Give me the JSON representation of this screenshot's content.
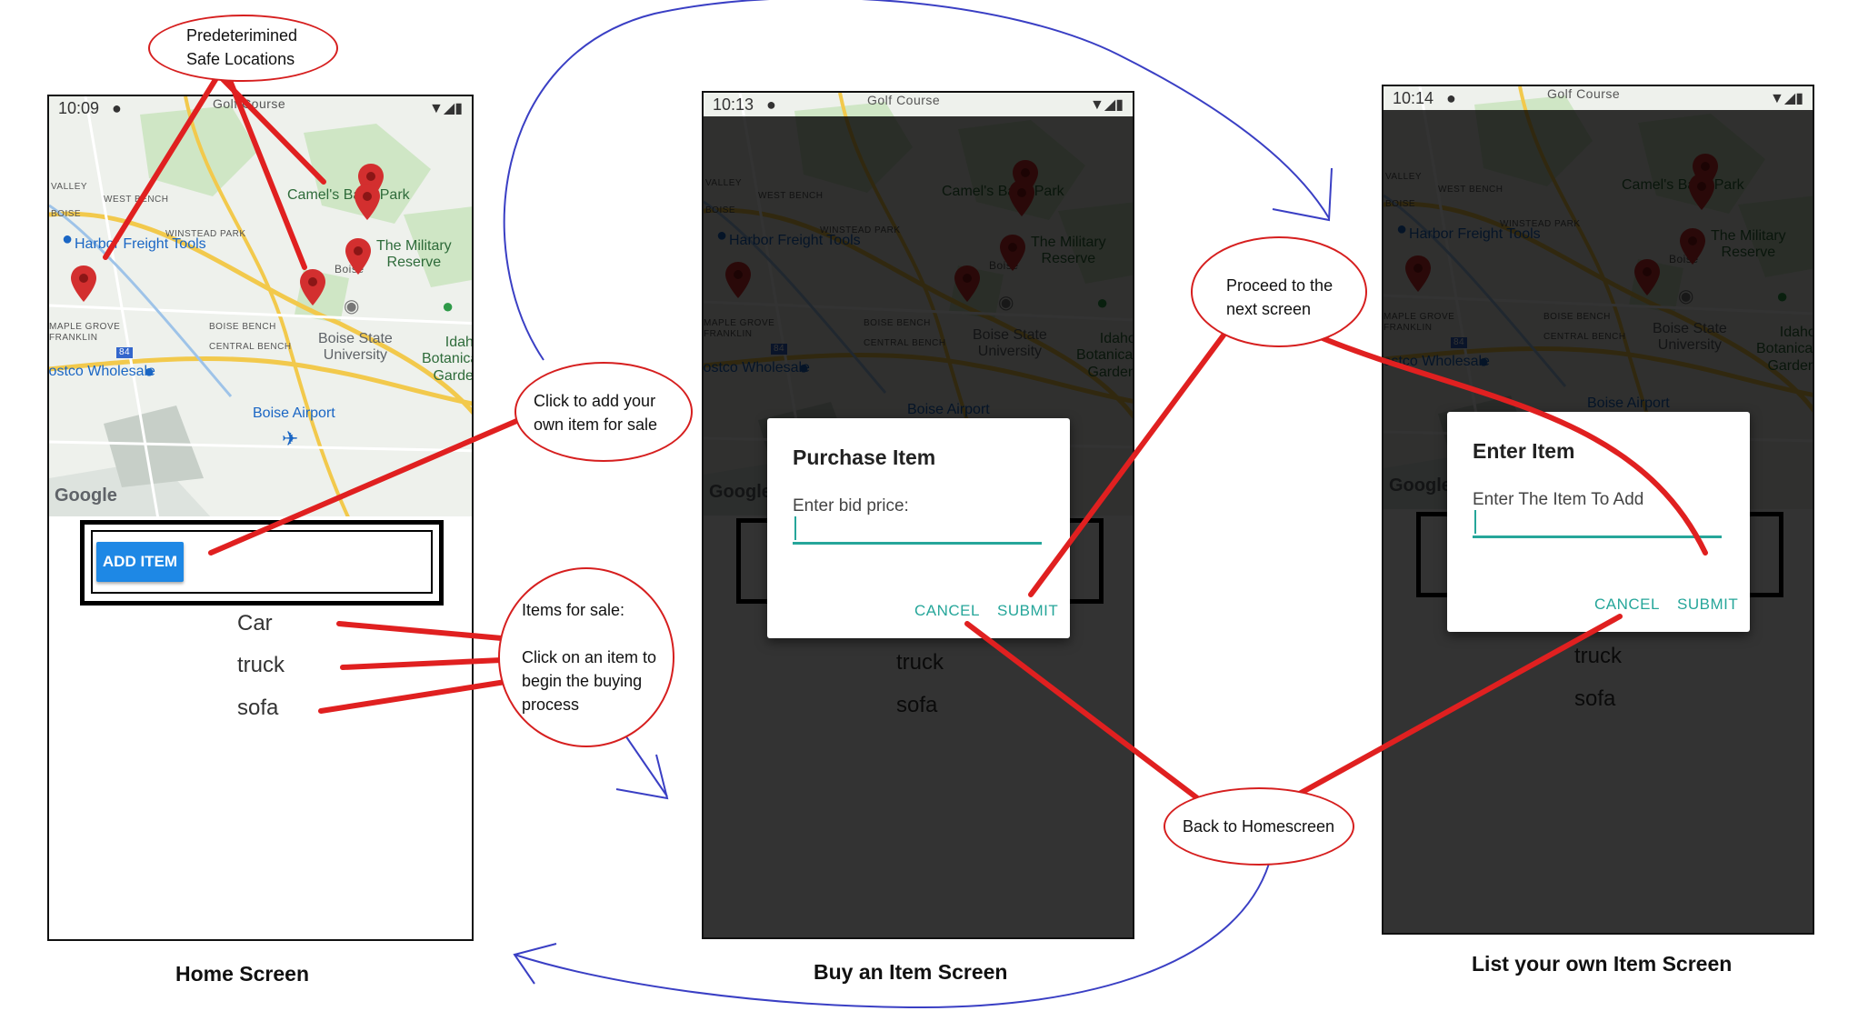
{
  "captions": {
    "home": "Home Screen",
    "buy": "Buy an Item Screen",
    "list": "List your own Item Screen"
  },
  "callouts": {
    "safe_locations": "Predeterimined\nSafe Locations",
    "add_item": "Click to add your\nown item for sale",
    "items_for_sale": "Items for sale:\n\nClick on an item to\nbegin the buying\nprocess",
    "proceed": "Proceed to the\nnext screen",
    "back_home": "Back to Homescreen"
  },
  "status_times": {
    "home": "10:09",
    "buy": "10:13",
    "list": "10:14"
  },
  "map_labels": {
    "golf_course": "Golf Course",
    "valley": "VALLEY",
    "west_bench": "WEST BENCH",
    "boise_small": "BOISE",
    "camel_park": "Camel's Back Park",
    "winstead_park": "WINSTEAD PARK",
    "harbor_freight": "Harbor Freight Tools",
    "military_reserve": "The Military\nReserve",
    "boise_city": "Boise",
    "maple_grove": "MAPLE GROVE\nFRANKLIN",
    "boise_bench": "BOISE BENCH",
    "central_bench": "CENTRAL BENCH",
    "boise_state": "Boise State\nUniversity",
    "idaho_botanical": "Idaho\nBotanical\nGarden",
    "costco": "Costco Wholesale",
    "boise_airport": "Boise Airport",
    "route_84": "84",
    "google": "Google"
  },
  "home": {
    "add_item_label": "ADD ITEM",
    "items": [
      "Car",
      "truck",
      "sofa"
    ]
  },
  "buy": {
    "dialog_title": "Purchase Item",
    "dialog_message": "Enter bid price:",
    "cancel_label": "CANCEL",
    "submit_label": "SUBMIT",
    "items": [
      "truck",
      "sofa"
    ]
  },
  "list": {
    "dialog_title": "Enter Item",
    "dialog_message": "Enter The Item To Add",
    "cancel_label": "CANCEL",
    "submit_label": "SUBMIT",
    "items": [
      "truck",
      "sofa"
    ]
  },
  "colors": {
    "callout_red": "#d61f1f",
    "flow_blue": "#3a3fc4",
    "accent_teal": "#26a69a",
    "button_blue": "#1e88e5"
  }
}
